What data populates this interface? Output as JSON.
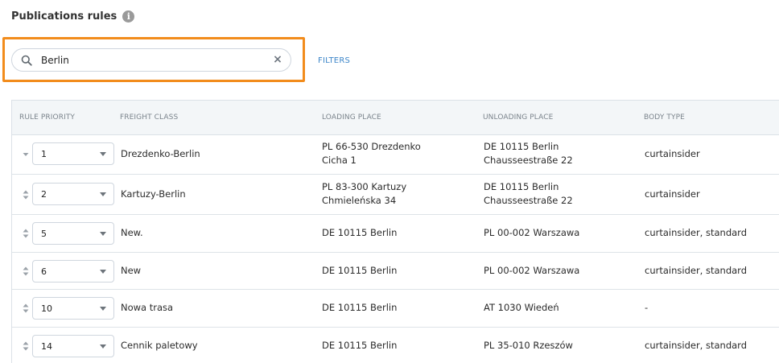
{
  "page": {
    "title": "Publications rules",
    "info_icon": "info-icon"
  },
  "search": {
    "value": "Berlin",
    "placeholder": "",
    "clear_icon": "close-icon",
    "search_icon": "search-icon"
  },
  "filters_label": "FILTERS",
  "colors": {
    "highlight": "#f28c1c",
    "link": "#3d86c9",
    "header_bg": "#f3f6f8"
  },
  "table": {
    "headers": {
      "priority": "RULE PRIORITY",
      "freight_class": "FREIGHT CLASS",
      "loading_place": "LOADING PLACE",
      "unloading_place": "UNLOADING PLACE",
      "body_type": "BODY TYPE"
    },
    "rows": [
      {
        "priority": "1",
        "freight_class": "Drezdenko-Berlin",
        "loading_line1": "PL 66-530 Drezdenko",
        "loading_line2": "Cicha 1",
        "unloading_line1": "DE 10115 Berlin",
        "unloading_line2": "Chausseestraße 22",
        "body_type": "curtainsider"
      },
      {
        "priority": "2",
        "freight_class": "Kartuzy-Berlin",
        "loading_line1": "PL 83-300 Kartuzy",
        "loading_line2": "Chmieleńska 34",
        "unloading_line1": "DE 10115 Berlin",
        "unloading_line2": "Chausseestraße 22",
        "body_type": "curtainsider"
      },
      {
        "priority": "5",
        "freight_class": "New.",
        "loading_line1": "DE 10115 Berlin",
        "loading_line2": "",
        "unloading_line1": "PL 00-002 Warszawa",
        "unloading_line2": "",
        "body_type": "curtainsider, standard"
      },
      {
        "priority": "6",
        "freight_class": "New",
        "loading_line1": "DE 10115 Berlin",
        "loading_line2": "",
        "unloading_line1": "PL 00-002 Warszawa",
        "unloading_line2": "",
        "body_type": "curtainsider, standard"
      },
      {
        "priority": "10",
        "freight_class": "Nowa trasa",
        "loading_line1": "DE 10115 Berlin",
        "loading_line2": "",
        "unloading_line1": "AT 1030 Wiedeń",
        "unloading_line2": "",
        "body_type": "-"
      },
      {
        "priority": "14",
        "freight_class": "Cennik paletowy",
        "loading_line1": "DE 10115 Berlin",
        "loading_line2": "",
        "unloading_line1": "PL 35-010 Rzeszów",
        "unloading_line2": "",
        "body_type": "curtainsider, standard"
      }
    ]
  }
}
